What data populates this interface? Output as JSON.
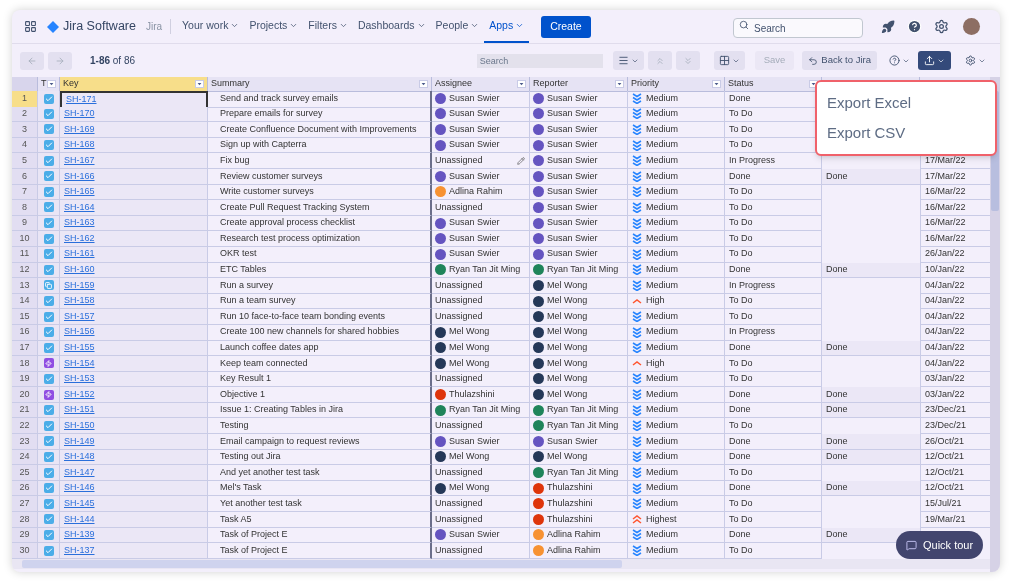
{
  "nav": {
    "product": "Jira Software",
    "site": "Jira",
    "menus": [
      {
        "label": "Your work",
        "selected": false
      },
      {
        "label": "Projects",
        "selected": false
      },
      {
        "label": "Filters",
        "selected": false
      },
      {
        "label": "Dashboards",
        "selected": false
      },
      {
        "label": "People",
        "selected": false
      },
      {
        "label": "Apps",
        "selected": true
      }
    ],
    "create": "Create",
    "search": {
      "placeholder": "Search"
    }
  },
  "toolbar": {
    "range": "1-86",
    "of": "of 86",
    "search": {
      "placeholder": "Search"
    },
    "save": {
      "label": "Save",
      "disabled": true
    },
    "back": "Back to Jira"
  },
  "table": {
    "columns": [
      {
        "label": "T",
        "selected": false
      },
      {
        "label": "Key",
        "selected": true
      },
      {
        "label": "Summary",
        "selected": false
      },
      {
        "label": "Assignee",
        "selected": false
      },
      {
        "label": "Reporter",
        "selected": false
      },
      {
        "label": "Priority",
        "selected": false
      },
      {
        "label": "Status",
        "selected": false
      }
    ],
    "rows": [
      {
        "num": "1",
        "kind": "task",
        "key": "SH-171",
        "summary": "Send and track survey emails",
        "assignee": {
          "name": "Susan Swier",
          "color": "#6554c0"
        },
        "reporter": {
          "name": "Susan Swier",
          "color": "#6554c0"
        },
        "priority": {
          "label": "Medium",
          "kind": "medium"
        },
        "status": "Done",
        "selected": true,
        "editing": false
      },
      {
        "num": "2",
        "kind": "task",
        "key": "SH-170",
        "summary": "Prepare emails for survey",
        "assignee": {
          "name": "Susan Swier",
          "color": "#6554c0"
        },
        "reporter": {
          "name": "Susan Swier",
          "color": "#6554c0"
        },
        "priority": {
          "label": "Medium",
          "kind": "medium"
        },
        "status": "To Do",
        "selected": false,
        "editing": false
      },
      {
        "num": "3",
        "kind": "task",
        "key": "SH-169",
        "summary": "Create Confluence Document with Improvements",
        "assignee": {
          "name": "Susan Swier",
          "color": "#6554c0"
        },
        "reporter": {
          "name": "Susan Swier",
          "color": "#6554c0"
        },
        "priority": {
          "label": "Medium",
          "kind": "medium"
        },
        "status": "To Do",
        "selected": false,
        "editing": false
      },
      {
        "num": "4",
        "kind": "task",
        "key": "SH-168",
        "summary": "Sign up with Capterra",
        "assignee": {
          "name": "Susan Swier",
          "color": "#6554c0"
        },
        "reporter": {
          "name": "Susan Swier",
          "color": "#6554c0"
        },
        "priority": {
          "label": "Medium",
          "kind": "medium"
        },
        "status": "To Do",
        "selected": false,
        "editing": false
      },
      {
        "num": "5",
        "kind": "task",
        "key": "SH-167",
        "summary": "Fix bug",
        "assignee": {
          "name": "Unassigned"
        },
        "reporter": {
          "name": "Susan Swier",
          "color": "#6554c0"
        },
        "priority": {
          "label": "Medium",
          "kind": "medium"
        },
        "status": "In Progress",
        "date": "17/Mar/22",
        "selected": false,
        "editing": true
      },
      {
        "num": "6",
        "kind": "task",
        "key": "SH-166",
        "summary": "Review customer surveys",
        "assignee": {
          "name": "Susan Swier",
          "color": "#6554c0"
        },
        "reporter": {
          "name": "Susan Swier",
          "color": "#6554c0"
        },
        "priority": {
          "label": "Medium",
          "kind": "medium"
        },
        "status": "Done",
        "column_7": "Done",
        "date": "17/Mar/22",
        "selected": false,
        "editing": false
      },
      {
        "num": "7",
        "kind": "task",
        "key": "SH-165",
        "summary": "Write customer surveys",
        "assignee": {
          "name": "Adlina Rahim",
          "color": "#f79232"
        },
        "reporter": {
          "name": "Susan Swier",
          "color": "#6554c0"
        },
        "priority": {
          "label": "Medium",
          "kind": "medium"
        },
        "status": "To Do",
        "date": "16/Mar/22",
        "selected": false,
        "editing": false
      },
      {
        "num": "8",
        "kind": "task",
        "key": "SH-164",
        "summary": "Create Pull Request Tracking System",
        "assignee": {
          "name": "Unassigned"
        },
        "reporter": {
          "name": "Susan Swier",
          "color": "#6554c0"
        },
        "priority": {
          "label": "Medium",
          "kind": "medium"
        },
        "status": "To Do",
        "date": "16/Mar/22",
        "selected": false,
        "editing": false
      },
      {
        "num": "9",
        "kind": "task",
        "key": "SH-163",
        "summary": "Create approval process checklist",
        "assignee": {
          "name": "Susan Swier",
          "color": "#6554c0"
        },
        "reporter": {
          "name": "Susan Swier",
          "color": "#6554c0"
        },
        "priority": {
          "label": "Medium",
          "kind": "medium"
        },
        "status": "To Do",
        "date": "16/Mar/22",
        "selected": false,
        "editing": false
      },
      {
        "num": "10",
        "kind": "task",
        "key": "SH-162",
        "summary": "Research test process optimization",
        "assignee": {
          "name": "Susan Swier",
          "color": "#6554c0"
        },
        "reporter": {
          "name": "Susan Swier",
          "color": "#6554c0"
        },
        "priority": {
          "label": "Medium",
          "kind": "medium"
        },
        "status": "To Do",
        "date": "16/Mar/22",
        "selected": false,
        "editing": false
      },
      {
        "num": "11",
        "kind": "task",
        "key": "SH-161",
        "summary": "OKR test",
        "assignee": {
          "name": "Susan Swier",
          "color": "#6554c0"
        },
        "reporter": {
          "name": "Susan Swier",
          "color": "#6554c0"
        },
        "priority": {
          "label": "Medium",
          "kind": "medium"
        },
        "status": "To Do",
        "date": "26/Jan/22",
        "selected": false,
        "editing": false
      },
      {
        "num": "12",
        "kind": "task",
        "key": "SH-160",
        "summary": "ETC Tables",
        "assignee": {
          "name": "Ryan Tan Jit Ming",
          "color": "#1f845a"
        },
        "reporter": {
          "name": "Ryan Tan Jit Ming",
          "color": "#1f845a"
        },
        "priority": {
          "label": "Medium",
          "kind": "medium"
        },
        "status": "Done",
        "column_7": "Done",
        "date": "10/Jan/22",
        "selected": false,
        "editing": false
      },
      {
        "num": "13",
        "kind": "subtask",
        "key": "SH-159",
        "summary": "Run a survey",
        "assignee": {
          "name": "Unassigned"
        },
        "reporter": {
          "name": "Mel Wong",
          "color": "#253858"
        },
        "priority": {
          "label": "Medium",
          "kind": "medium"
        },
        "status": "In Progress",
        "date": "04/Jan/22",
        "selected": false,
        "editing": false
      },
      {
        "num": "14",
        "kind": "task",
        "key": "SH-158",
        "summary": "Run a team survey",
        "assignee": {
          "name": "Unassigned"
        },
        "reporter": {
          "name": "Mel Wong",
          "color": "#253858"
        },
        "priority": {
          "label": "High",
          "kind": "high"
        },
        "status": "To Do",
        "date": "04/Jan/22",
        "selected": false,
        "editing": false
      },
      {
        "num": "15",
        "kind": "task",
        "key": "SH-157",
        "summary": "Run 10 face-to-face team bonding events",
        "assignee": {
          "name": "Unassigned"
        },
        "reporter": {
          "name": "Mel Wong",
          "color": "#253858"
        },
        "priority": {
          "label": "Medium",
          "kind": "medium"
        },
        "status": "To Do",
        "date": "04/Jan/22",
        "selected": false,
        "editing": false
      },
      {
        "num": "16",
        "kind": "task",
        "key": "SH-156",
        "summary": "Create 100 new channels for shared hobbies",
        "assignee": {
          "name": "Mel Wong",
          "color": "#253858"
        },
        "reporter": {
          "name": "Mel Wong",
          "color": "#253858"
        },
        "priority": {
          "label": "Medium",
          "kind": "medium"
        },
        "status": "In Progress",
        "date": "04/Jan/22",
        "selected": false,
        "editing": false
      },
      {
        "num": "17",
        "kind": "task",
        "key": "SH-155",
        "summary": "Launch coffee dates app",
        "assignee": {
          "name": "Mel Wong",
          "color": "#253858"
        },
        "reporter": {
          "name": "Mel Wong",
          "color": "#253858"
        },
        "priority": {
          "label": "Medium",
          "kind": "medium"
        },
        "status": "Done",
        "column_7": "Done",
        "date": "04/Jan/22",
        "selected": false,
        "editing": false
      },
      {
        "num": "18",
        "kind": "epic",
        "key": "SH-154",
        "summary": "Keep team connected",
        "assignee": {
          "name": "Mel Wong",
          "color": "#253858"
        },
        "reporter": {
          "name": "Mel Wong",
          "color": "#253858"
        },
        "priority": {
          "label": "High",
          "kind": "high"
        },
        "status": "To Do",
        "date": "04/Jan/22",
        "selected": false,
        "editing": false
      },
      {
        "num": "19",
        "kind": "task",
        "key": "SH-153",
        "summary": "Key Result 1",
        "assignee": {
          "name": "Unassigned"
        },
        "reporter": {
          "name": "Mel Wong",
          "color": "#253858"
        },
        "priority": {
          "label": "Medium",
          "kind": "medium"
        },
        "status": "To Do",
        "date": "03/Jan/22",
        "selected": false,
        "editing": false
      },
      {
        "num": "20",
        "kind": "epic",
        "key": "SH-152",
        "summary": "Objective 1",
        "assignee": {
          "name": "Thulazshini",
          "color": "#de350b"
        },
        "reporter": {
          "name": "Mel Wong",
          "color": "#253858"
        },
        "priority": {
          "label": "Medium",
          "kind": "medium"
        },
        "status": "Done",
        "column_7": "Done",
        "date": "03/Jan/22",
        "selected": false,
        "editing": false
      },
      {
        "num": "21",
        "kind": "task",
        "key": "SH-151",
        "summary": "Issue 1: Creating Tables in Jira",
        "assignee": {
          "name": "Ryan Tan Jit Ming",
          "color": "#1f845a"
        },
        "reporter": {
          "name": "Ryan Tan Jit Ming",
          "color": "#1f845a"
        },
        "priority": {
          "label": "Medium",
          "kind": "medium"
        },
        "status": "Done",
        "column_7": "Done",
        "date": "23/Dec/21",
        "selected": false,
        "editing": false
      },
      {
        "num": "22",
        "kind": "task",
        "key": "SH-150",
        "summary": "Testing",
        "assignee": {
          "name": "Unassigned"
        },
        "reporter": {
          "name": "Ryan Tan Jit Ming",
          "color": "#1f845a"
        },
        "priority": {
          "label": "Medium",
          "kind": "medium"
        },
        "status": "To Do",
        "date": "23/Dec/21",
        "selected": false,
        "editing": false
      },
      {
        "num": "23",
        "kind": "task",
        "key": "SH-149",
        "summary": "Email campaign to request reviews",
        "assignee": {
          "name": "Susan Swier",
          "color": "#6554c0"
        },
        "reporter": {
          "name": "Susan Swier",
          "color": "#6554c0"
        },
        "priority": {
          "label": "Medium",
          "kind": "medium"
        },
        "status": "Done",
        "column_7": "Done",
        "date": "26/Oct/21",
        "selected": false,
        "editing": false
      },
      {
        "num": "24",
        "kind": "task",
        "key": "SH-148",
        "summary": "Testing out Jira",
        "assignee": {
          "name": "Mel Wong",
          "color": "#253858"
        },
        "reporter": {
          "name": "Mel Wong",
          "color": "#253858"
        },
        "priority": {
          "label": "Medium",
          "kind": "medium"
        },
        "status": "Done",
        "column_7": "Done",
        "date": "12/Oct/21",
        "selected": false,
        "editing": false
      },
      {
        "num": "25",
        "kind": "task",
        "key": "SH-147",
        "summary": "And yet another test task",
        "assignee": {
          "name": "Unassigned"
        },
        "reporter": {
          "name": "Ryan Tan Jit Ming",
          "color": "#1f845a"
        },
        "priority": {
          "label": "Medium",
          "kind": "medium"
        },
        "status": "To Do",
        "date": "12/Oct/21",
        "selected": false,
        "editing": false
      },
      {
        "num": "26",
        "kind": "task",
        "key": "SH-146",
        "summary": "Mel's Task",
        "assignee": {
          "name": "Mel Wong",
          "color": "#253858"
        },
        "reporter": {
          "name": "Thulazshini",
          "color": "#de350b"
        },
        "priority": {
          "label": "Medium",
          "kind": "medium"
        },
        "status": "Done",
        "column_7": "Done",
        "date": "12/Oct/21",
        "selected": false,
        "editing": false
      },
      {
        "num": "27",
        "kind": "task",
        "key": "SH-145",
        "summary": "Yet another test task",
        "assignee": {
          "name": "Unassigned"
        },
        "reporter": {
          "name": "Thulazshini",
          "color": "#de350b"
        },
        "priority": {
          "label": "Medium",
          "kind": "medium"
        },
        "status": "To Do",
        "date": "15/Jul/21",
        "selected": false,
        "editing": false
      },
      {
        "num": "28",
        "kind": "task",
        "key": "SH-144",
        "summary": "Task A5",
        "assignee": {
          "name": "Unassigned"
        },
        "reporter": {
          "name": "Thulazshini",
          "color": "#de350b"
        },
        "priority": {
          "label": "Highest",
          "kind": "highest"
        },
        "status": "To Do",
        "date": "19/Mar/21",
        "selected": false,
        "editing": false
      },
      {
        "num": "29",
        "kind": "task",
        "key": "SH-139",
        "summary": "Task of Project E",
        "assignee": {
          "name": "Susan Swier",
          "color": "#6554c0"
        },
        "reporter": {
          "name": "Adlina Rahim",
          "color": "#f79232"
        },
        "priority": {
          "label": "Medium",
          "kind": "medium"
        },
        "status": "Done",
        "column_7": "Done",
        "selected": false,
        "editing": false
      },
      {
        "num": "30",
        "kind": "task",
        "key": "SH-137",
        "summary": "Task of Project E",
        "assignee": {
          "name": "Unassigned"
        },
        "reporter": {
          "name": "Adlina Rahim",
          "color": "#f79232"
        },
        "priority": {
          "label": "Medium",
          "kind": "medium"
        },
        "status": "To Do",
        "selected": false,
        "editing": false
      }
    ]
  },
  "export_menu": {
    "items": [
      "Export Excel",
      "Export CSV"
    ]
  },
  "quick_tour": "Quick tour"
}
